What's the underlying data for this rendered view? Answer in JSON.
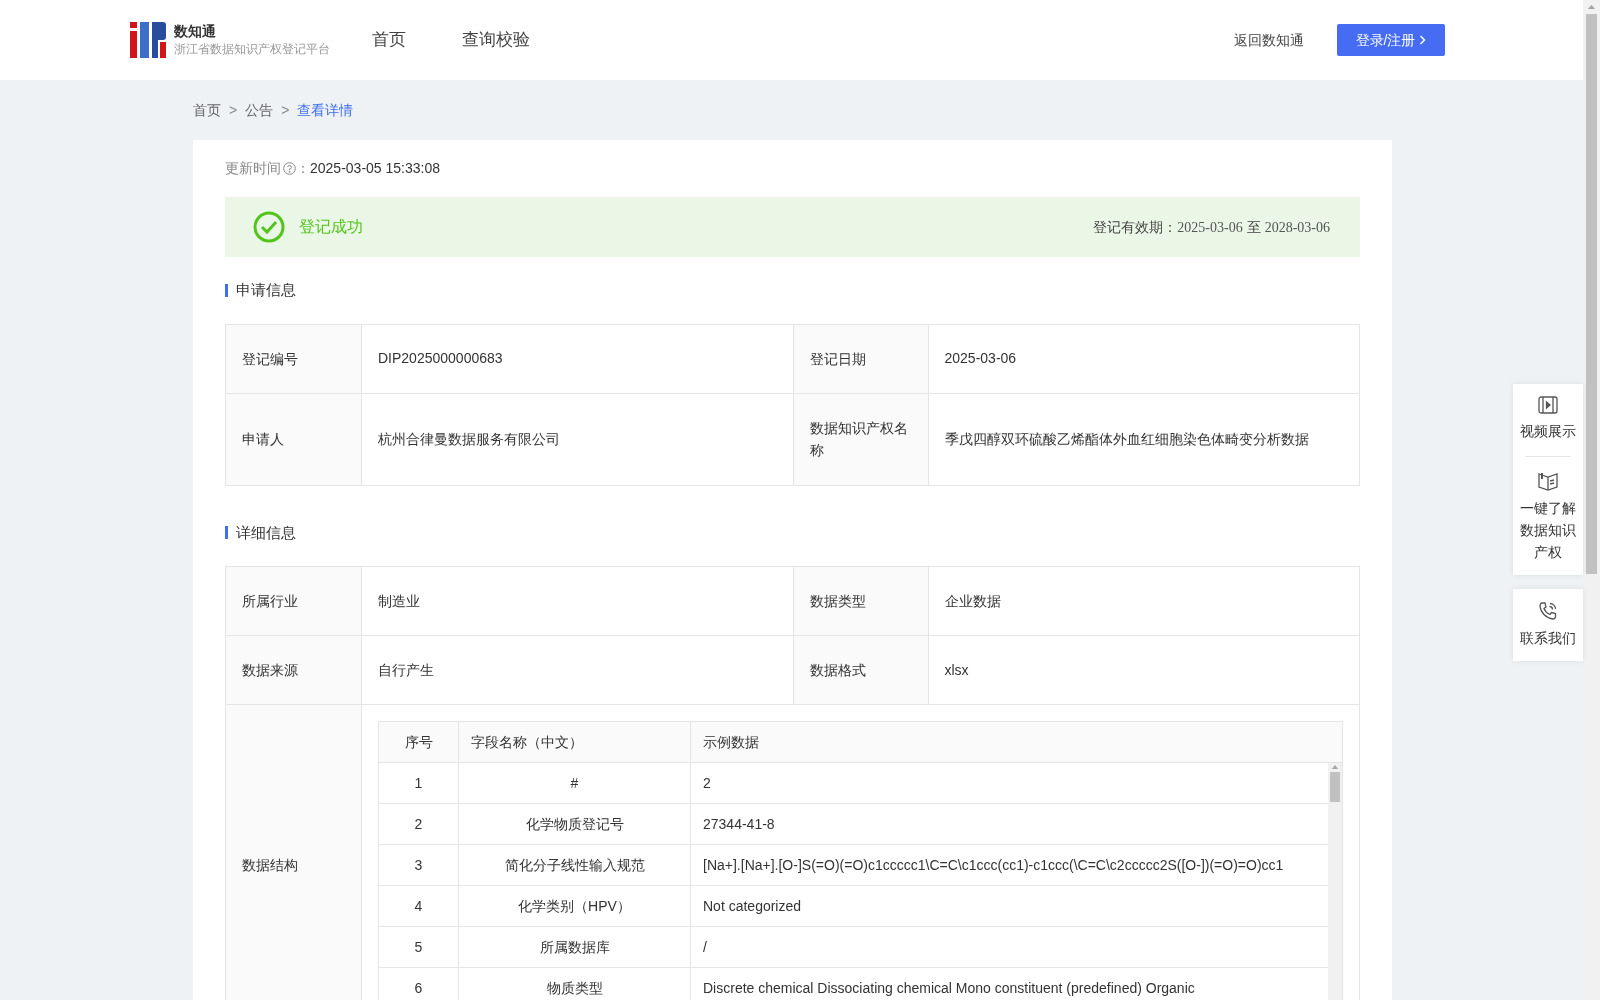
{
  "header": {
    "logo_title": "数知通",
    "logo_subtitle": "浙江省数据知识产权登记平台",
    "nav": [
      "首页",
      "查询校验"
    ],
    "back_link": "返回数知通",
    "login_button": "登录/注册"
  },
  "breadcrumb": {
    "separator": ">",
    "items": [
      {
        "label": "首页",
        "current": false
      },
      {
        "label": "公告",
        "current": false
      },
      {
        "label": "查看详情",
        "current": true
      }
    ]
  },
  "update": {
    "label": "更新时间",
    "colon": "：",
    "value": "2025-03-05 15:33:08"
  },
  "status": {
    "text": "登记成功",
    "validity_label": "登记有效期：",
    "start": "2025-03-06",
    "to": "至",
    "end": "2028-03-06"
  },
  "application": {
    "title": "申请信息",
    "rows": [
      [
        {
          "label": "登记编号",
          "value": "DIP2025000000683"
        },
        {
          "label": "登记日期",
          "value": "2025-03-06"
        }
      ],
      [
        {
          "label": "申请人",
          "value": "杭州合律曼数据服务有限公司"
        },
        {
          "label": "数据知识产权名称",
          "value": "季戊四醇双环硫酸乙烯酯体外血红细胞染色体畸变分析数据"
        }
      ]
    ]
  },
  "details": {
    "title": "详细信息",
    "rows": [
      [
        {
          "label": "所属行业",
          "value": "制造业"
        },
        {
          "label": "数据类型",
          "value": "企业数据"
        }
      ],
      [
        {
          "label": "数据来源",
          "value": "自行产生"
        },
        {
          "label": "数据格式",
          "value": "xlsx"
        }
      ]
    ],
    "structure": {
      "label": "数据结构",
      "columns": [
        "序号",
        "字段名称（中文）",
        "示例数据"
      ],
      "rows": [
        [
          "1",
          "#",
          "2"
        ],
        [
          "2",
          "化学物质登记号",
          "27344-41-8"
        ],
        [
          "3",
          "简化分子线性输入规范",
          "[Na+].[Na+].[O-]S(=O)(=O)c1ccccc1\\C=C\\c1ccc(cc1)-c1ccc(\\C=C\\c2ccccc2S([O-])(=O)=O)cc1"
        ],
        [
          "4",
          "化学类别（HPV）",
          "Not categorized"
        ],
        [
          "5",
          "所属数据库",
          "/"
        ],
        [
          "6",
          "物质类型",
          "Discrete chemical Dissociating chemical Mono constituent (predefined) Organic"
        ]
      ]
    }
  },
  "side_panel": {
    "groups": [
      [
        {
          "kind": "video",
          "label": "视频展示"
        },
        {
          "kind": "book",
          "label": "一键了解数据知识产权"
        }
      ],
      [
        {
          "kind": "phone",
          "label": "联系我们"
        }
      ]
    ]
  }
}
